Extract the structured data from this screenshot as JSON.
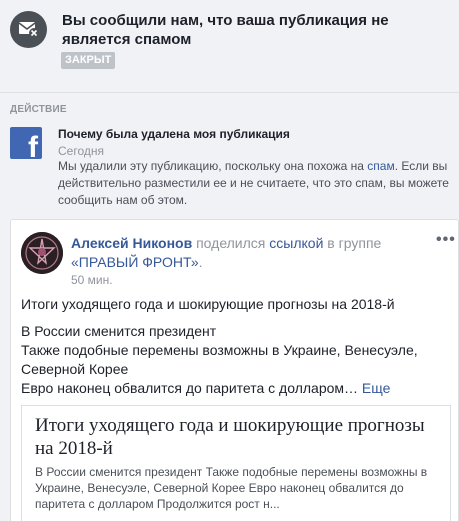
{
  "notice": {
    "icon": "envelope-x-icon",
    "title": "Вы сообщили нам, что ваша публикация не является спамом",
    "status_badge": "ЗАКРЫТ"
  },
  "action": {
    "section_label": "ДЕЙСТВИЕ",
    "logo_icon": "facebook-logo-icon",
    "logo_letter": "f",
    "title": "Почему была удалена моя публикация",
    "date": "Сегодня",
    "body_before": "Мы удалили эту публикацию, поскольку она похожа на ",
    "body_link": "спам",
    "body_after": ". Если вы действительно разместили ее и не считаете, что это спам, вы можете сообщить нам об этом."
  },
  "post": {
    "author": "Алексей Никонов",
    "shared_text": " поделился ",
    "shared_link": "ссылкой",
    "group_prefix": " в группе ",
    "group_name": "«ПРАВЫЙ ФРОНТ»",
    "group_suffix": ".",
    "time": "50 мин.",
    "more_icon": "more-options-icon",
    "more_glyph": "•••",
    "text_title": "Итоги уходящего года и шокирующие прогнозы на 2018-й",
    "text_lines": [
      "В России сменится президент",
      "Также подобные перемены возможны в Украине, Венесуэле,",
      "Северной Корее"
    ],
    "text_last": "Евро наконец обвалится до паритета с долларом… ",
    "more_link": "Еще",
    "preview": {
      "title": "Итоги уходящего года и шокирующие прогнозы на 2018-й",
      "description": "В России сменится президент Также подобные перемены возможны в Украине, Венесуэле, Северной Корее Евро наконец обвалится до паритета с долларом Продолжится рост н..."
    }
  },
  "colors": {
    "background": "#f1f2f6",
    "link": "#365899",
    "facebook_blue": "#4267b2",
    "badge_gray": "#bec2c9"
  }
}
